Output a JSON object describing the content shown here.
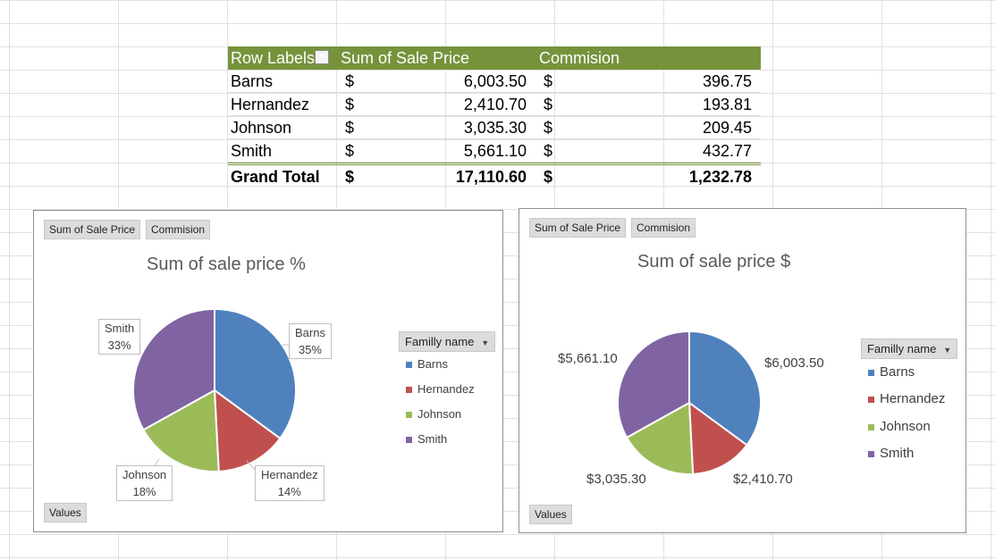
{
  "pivot": {
    "headers": {
      "row_labels": "Row Labels",
      "sum_sale_price": "Sum of Sale Price",
      "commission": "Commision"
    },
    "filter_icon": "filter-sort-icon",
    "rows": [
      {
        "name": "Barns",
        "cur1": "$",
        "sale": "6,003.50",
        "cur2": "$",
        "comm": "396.75"
      },
      {
        "name": "Hernandez",
        "cur1": "$",
        "sale": "2,410.70",
        "cur2": "$",
        "comm": "193.81"
      },
      {
        "name": "Johnson",
        "cur1": "$",
        "sale": "3,035.30",
        "cur2": "$",
        "comm": "209.45"
      },
      {
        "name": "Smith",
        "cur1": "$",
        "sale": "5,661.10",
        "cur2": "$",
        "comm": "432.77"
      }
    ],
    "total": {
      "name": "Grand Total",
      "cur1": "$",
      "sale": "17,110.60",
      "cur2": "$",
      "comm": "1,232.78"
    },
    "header_color": "#76933c"
  },
  "chart1": {
    "field_buttons": [
      "Sum of Sale Price",
      "Commision"
    ],
    "axis_button": "Values",
    "legend_header": "Familly name",
    "data_labels": [
      {
        "name": "Barns",
        "pct": "35%"
      },
      {
        "name": "Hernandez",
        "pct": "14%"
      },
      {
        "name": "Johnson",
        "pct": "18%"
      },
      {
        "name": "Smith",
        "pct": "33%"
      }
    ]
  },
  "chart2": {
    "field_buttons": [
      "Sum of Sale Price",
      "Commision"
    ],
    "axis_button": "Values",
    "legend_header": "Familly name",
    "data_labels": [
      "$6,003.50",
      "$2,410.70",
      "$3,035.30",
      "$5,661.10"
    ]
  },
  "chart_data": [
    {
      "type": "pie",
      "title": "Sum of sale price %",
      "categories": [
        "Barns",
        "Hernandez",
        "Johnson",
        "Smith"
      ],
      "values": [
        6003.5,
        2410.7,
        3035.3,
        5661.1
      ],
      "colors": [
        "#4f81bd",
        "#c0504d",
        "#9bbb59",
        "#8064a2"
      ],
      "legend": "right"
    },
    {
      "type": "pie",
      "title": "Sum of sale price $",
      "categories": [
        "Barns",
        "Hernandez",
        "Johnson",
        "Smith"
      ],
      "values": [
        6003.5,
        2410.7,
        3035.3,
        5661.1
      ],
      "colors": [
        "#4f81bd",
        "#c0504d",
        "#9bbb59",
        "#8064a2"
      ],
      "legend": "right"
    }
  ]
}
